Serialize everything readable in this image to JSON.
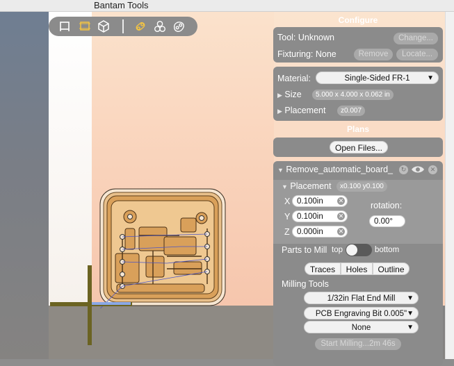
{
  "app": {
    "title": "Bantam Tools"
  },
  "toolbar": {
    "icons": [
      "bed-view-icon",
      "top-view-icon",
      "3d-view-icon",
      "traces-view-icon",
      "holes-view-icon",
      "outline-view-icon"
    ]
  },
  "configure": {
    "title": "Configure",
    "tool_label": "Tool: Unknown",
    "change_button": "Change...",
    "fixturing_label": "Fixturing: None",
    "remove_button": "Remove",
    "locate_button": "Locate...",
    "material_label": "Material:",
    "material_value": "Single-Sided FR-1",
    "size_label": "Size",
    "size_value": "5.000 x 4.000 x 0.062 in",
    "placement_label": "Placement",
    "placement_value": "z0.007"
  },
  "plans": {
    "title": "Plans",
    "open_files_button": "Open Files...",
    "file_name": "Remove_automatic_board_",
    "placement_label": "Placement",
    "placement_value": "x0.100 y0.100",
    "x_label": "X",
    "x_value": "0.100in",
    "y_label": "Y",
    "y_value": "0.100in",
    "z_label": "Z",
    "z_value": "0.000in",
    "rotation_label": "rotation:",
    "rotation_value": "0.00°",
    "parts_label": "Parts to Mill",
    "top_label": "top",
    "bottom_label": "bottom",
    "tabs": [
      "Traces",
      "Holes",
      "Outline"
    ],
    "milling_tools_label": "Milling Tools",
    "tools": [
      "1/32in Flat End Mill",
      "PCB Engraving Bit 0.005\"",
      "None"
    ],
    "start_button": "Start Milling...2m 46s"
  },
  "colors": {
    "panel": "#8b8b8b",
    "bed": "#f9d2ba",
    "trace": "#d9a05a",
    "axis_x": "#6b6322",
    "axis_blue": "#8aa8e6"
  }
}
